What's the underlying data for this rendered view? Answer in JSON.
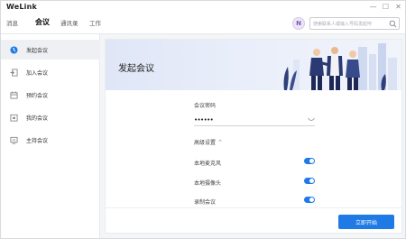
{
  "app": {
    "name": "WeLink",
    "window_controls": [
      "—",
      "☐",
      "✕"
    ]
  },
  "nav": {
    "tabs": [
      {
        "label": "消息",
        "active": false
      },
      {
        "label": "会议",
        "active": true
      },
      {
        "label": "通讯录",
        "active": false
      },
      {
        "label": "工作",
        "active": false
      }
    ],
    "avatar_letter": "N",
    "search": {
      "placeholder": "搜索联系人或输入号码发起呼"
    }
  },
  "sidebar": {
    "items": [
      {
        "label": "发起会议",
        "icon": "video-call-icon",
        "active": true
      },
      {
        "label": "加入会议",
        "icon": "join-meeting-icon",
        "active": false
      },
      {
        "label": "预约会议",
        "icon": "calendar-icon",
        "active": false
      },
      {
        "label": "我的会议",
        "icon": "my-meetings-icon",
        "active": false
      },
      {
        "label": "主持会议",
        "icon": "host-meeting-icon",
        "active": false
      }
    ]
  },
  "main": {
    "title": "发起会议",
    "password_label": "会议密码",
    "password_value": "••••••",
    "advanced_label": "高级设置",
    "options": [
      {
        "label": "本地麦克风",
        "enabled": true
      },
      {
        "label": "本地摄像头",
        "enabled": true
      },
      {
        "label": "录制会议",
        "enabled": true
      }
    ],
    "start_button": "立即开始"
  },
  "colors": {
    "accent": "#1f7ae6",
    "banner_start": "#dfe6f6",
    "banner_end": "#f2f4fb"
  }
}
